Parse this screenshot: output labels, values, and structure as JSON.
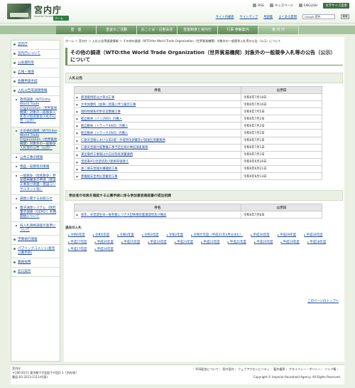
{
  "header": {
    "logo_jp": "宮内庁",
    "logo_en": "Imperial Household Agency",
    "home": "ホーム",
    "rss": "RSS",
    "kids": "キッズページ",
    "english": "ENGLISH",
    "color": "文字サイズ変更",
    "site_search": "サイト内検索",
    "sitemap": "サイトマップ",
    "glossary": "用語集",
    "faq": "よくある質問",
    "search_placeholder": "Google 提供",
    "search_button": "検索"
  },
  "gnav": [
    "皇　室",
    "皇室のご活動",
    "おことば・記者会見",
    "皇室制度と宮内庁",
    "行事 参観案内",
    "宮 内 庁"
  ],
  "sidebar": [
    {
      "label": "宮内庁"
    },
    {
      "label": "宮内庁について"
    },
    {
      "label": "公表資料等"
    },
    {
      "label": "広報・報道"
    },
    {
      "label": "各種申請手続"
    },
    {
      "label": "入札公告等調達情報"
    },
    {
      "label": "政府調達（WTO:the World Trade Organization（世界貿易機関）対象の一般競争入札及び指名競争入札の公告（公示）",
      "sub": true
    },
    {
      "label": "その他の調達（WTO:the World Trade Organization（世界貿易機関）対象外の一般競争入札等の公告（公示）",
      "sub": true
    },
    {
      "label": "公共工事の情報",
      "sub": true
    },
    {
      "label": "物品・役務等の情報",
      "sub": true
    },
    {
      "label": "一般競争（指名競争）参加資格審査の申請（建設工事及び測量・建設コンサルタント等）",
      "sub": true
    },
    {
      "label": "調達に関するお知らせ",
      "sub": true
    },
    {
      "label": "電子調達システム（政府電子調達（GEPS））利用開始について",
      "sub": true
    },
    {
      "label": "低入札価格調査の基準について",
      "sub": true
    },
    {
      "label": "予算執行情報"
    },
    {
      "label": "パブリックコメント(意見公募手続)"
    },
    {
      "label": "職員採用"
    },
    {
      "label": "窓口案内"
    }
  ],
  "breadcrumb": "ホーム ＞ 宮内庁 ＞ 入札公告等調達情報 ＞ その他の調達（WTO:the World Trade Organization（世界貿易機関）対象外の一般競争入札等の公告（公示）について",
  "page_title": "その他の調達（WTO:the World Trade Organization（世界貿易機関）対象外の一般競争入札等の公告（公示）について",
  "bid_section": {
    "heading": "入札公告",
    "col_name": "件名",
    "col_date": "公示日",
    "rows": [
      {
        "name": "那須御用邸ほか草刈工事",
        "date": "令和6年7月18日"
      },
      {
        "name": "大手休憩所（仮称）新築に伴う展示工事",
        "date": "令和6年7月16日"
      },
      {
        "name": "御料牧場各所更衣室整備工事",
        "date": "令和6年7月5日"
      },
      {
        "name": "軽自動車（バン2WD）の購入",
        "date": "令和6年7月2日"
      },
      {
        "name": "軽自動車（トラック4WD）の購入",
        "date": "令和6年7月2日"
      },
      {
        "name": "軽自動車（トラック2WD）の購入",
        "date": "令和6年7月2日"
      },
      {
        "name": "仁徳天皇陵における第2堤・外堤現況測量及び調査区測量業務",
        "date": "令和6年7月1日"
      },
      {
        "name": "仁徳天皇陵外堤整備工事予定区域の事前調査業務",
        "date": "令和6年7月1日"
      },
      {
        "name": "東宮御所工事場ほか石垣等再測量業務",
        "date": "令和6年7月1日"
      },
      {
        "name": "皇居東4号舎塗装及び屋根草張替え",
        "date": "令和6年6月26日"
      },
      {
        "name": "後二條天皇陵外構補修工事",
        "date": "令和6年6月21日"
      },
      {
        "name": "葬儀殿天皇用災害撤退工事",
        "date": "令和6年6月13日"
      }
    ]
  },
  "confirm_section": {
    "heading": "参加者の有無を確認する公募手続に係る参加意思確認書の提出招請",
    "col_name": "件名",
    "col_date": "公示日",
    "rows": [
      {
        "name": "新年、天皇誕生日一般参賀につき大型映像装置賃貸借及び撤去",
        "date": "令和6年7月8日"
      }
    ]
  },
  "past": {
    "title": "過去の入札",
    "years": [
      "令和6年度",
      "令和5年度",
      "令和4年度",
      "令和3年度",
      "令和2年度",
      "令和元年度（平成31年4月分含む）",
      "平成30年度",
      "平成29年度",
      "平成28年度",
      "平成27年度",
      "平成26年度",
      "平成25年度",
      "平成24年度",
      "平成23年度",
      "平成22年度",
      "平成21年度",
      "平成20年度",
      "平成19年度",
      "平成18年度",
      "平成17年度",
      "平成16年度"
    ]
  },
  "to_top": "このページのトップへ",
  "footer": {
    "org": "宮内庁",
    "address": "〒100-8111 東京都千代田区千代田1-1［所在地］",
    "tel": "電話:03-3213-1111(代表)",
    "links": "｜ RSS配信について｜ 窓口案内｜ ウェブアクセシビリティ｜ 著作権等｜ プライバシー・ポリシー｜ リンク集｜",
    "copyright": "Copyright © Imperial Household Agency. All Rights Reserved."
  }
}
